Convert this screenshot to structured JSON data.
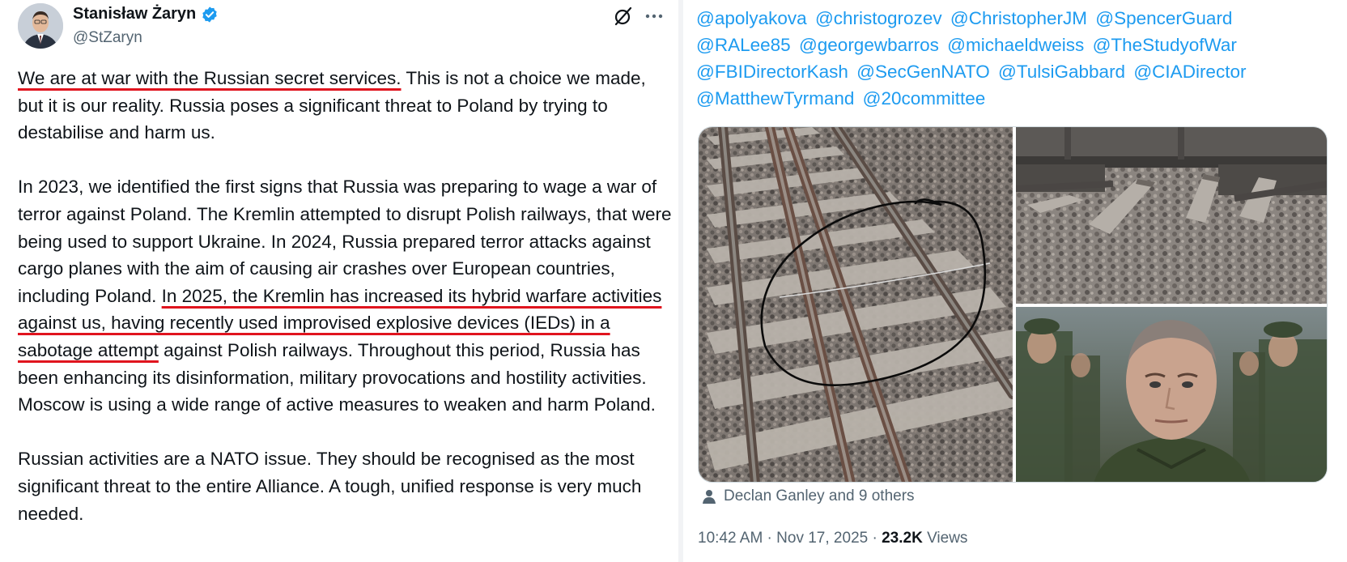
{
  "author": {
    "name": "Stanisław Żaryn",
    "handle": "@StZaryn"
  },
  "tweet": {
    "p1": {
      "underlined": "We are at war with the Russian secret services.",
      "rest": " This is not a choice we made, but it is our reality. Russia poses a significant threat to Poland by trying to destabilise and harm us."
    },
    "p2": {
      "before": "In 2023, we identified the first signs that Russia was preparing to wage a war of terror against Poland. The Kremlin attempted to disrupt Polish railways, that were being used to support Ukraine. In 2024, Russia prepared terror attacks against cargo planes with the aim of causing air crashes over European countries, including Poland. ",
      "underlined": "In 2025, the Kremlin has increased its hybrid warfare activities against us, having recently used improvised explosive devices (IEDs) in a sabotage attempt",
      "after": " against Polish railways. Throughout this period, Russia has been enhancing its disinformation, military provocations and hostility activities. Moscow is using a wide range of active measures to weaken and harm Poland."
    },
    "p3": "Russian activities are a NATO issue. They should be recognised as the most significant threat to the entire Alliance. A tough, unified response is very much needed."
  },
  "mentions": [
    "@apolyakova",
    "@christogrozev",
    "@ChristopherJM",
    "@SpencerGuard",
    "@RALee85",
    "@georgewbarros",
    "@michaeldweiss",
    "@TheStudyofWar",
    "@FBIDirectorKash",
    "@SecGenNATO",
    "@TulsiGabbard",
    "@CIADirector",
    "@MatthewTyrmand",
    "@20committee"
  ],
  "likes_text": "Declan Ganley and 9 others",
  "meta": {
    "time": "10:42 AM",
    "sep": " · ",
    "date": "Nov 17, 2025",
    "views_count": "23.2K",
    "views_label": " Views"
  },
  "colors": {
    "link": "#1d9bf0",
    "underline": "#e0141e",
    "verified": "#1d9bf0",
    "muted": "#536471"
  }
}
